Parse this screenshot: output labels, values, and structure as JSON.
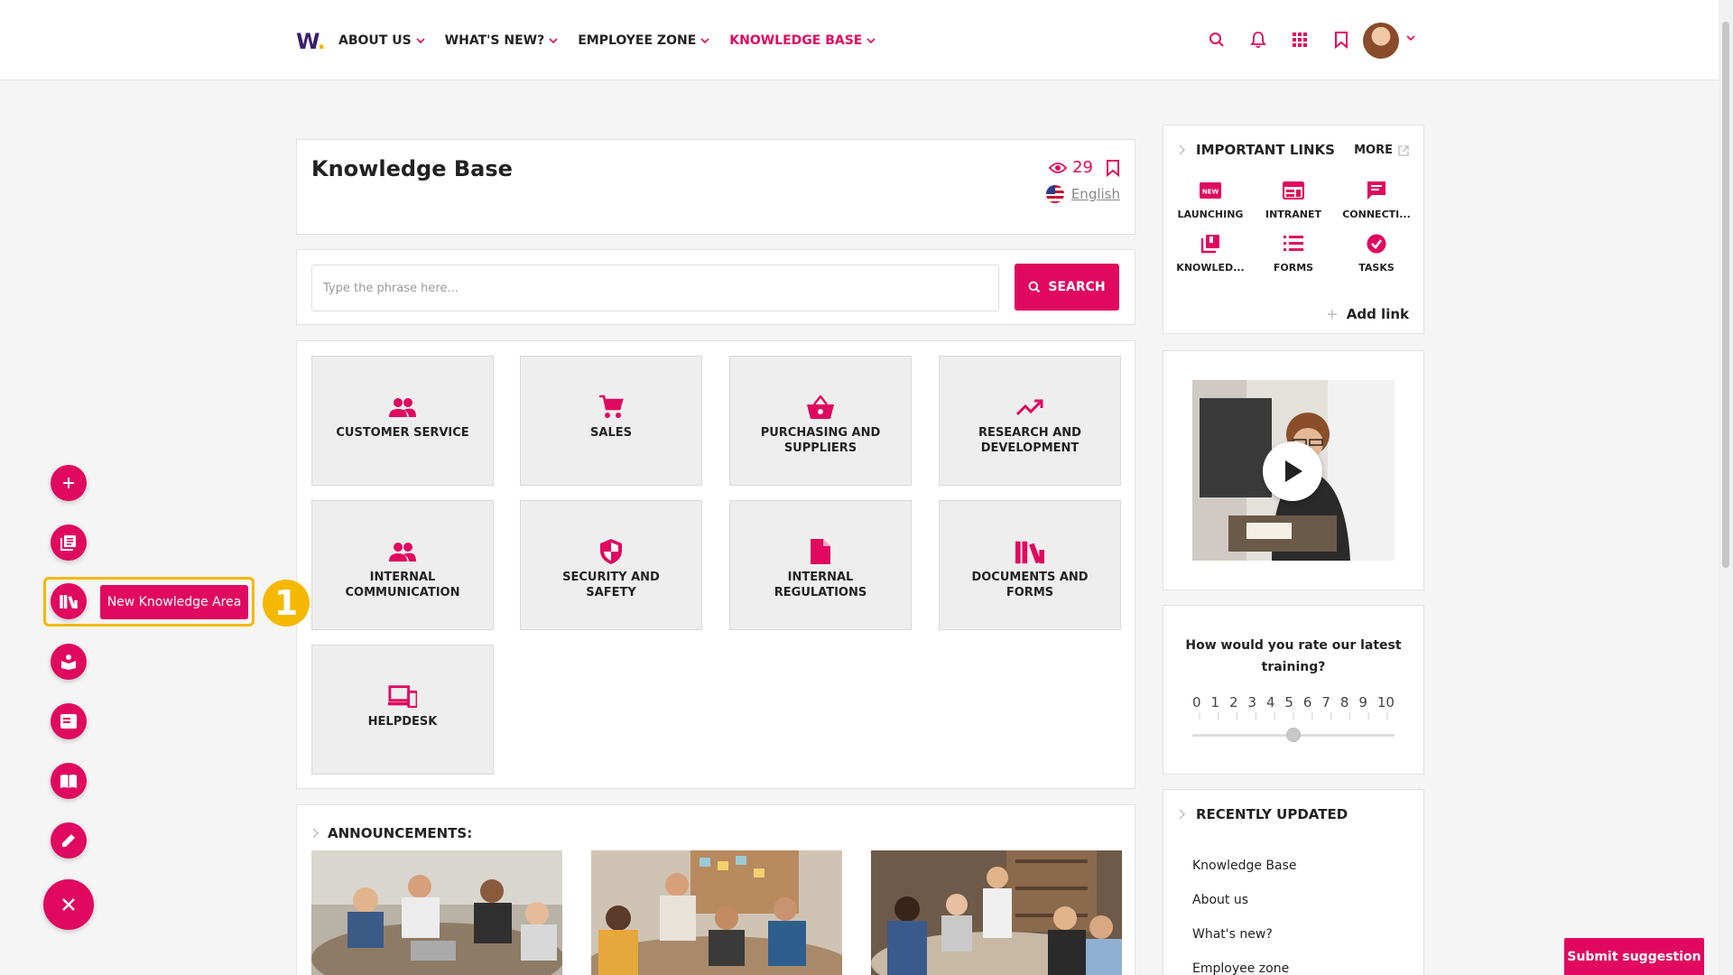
{
  "header": {
    "logo": "W",
    "nav": [
      {
        "label": "ABOUT US",
        "active": false
      },
      {
        "label": "WHAT'S NEW?",
        "active": false
      },
      {
        "label": "EMPLOYEE ZONE",
        "active": false
      },
      {
        "label": "KNOWLEDGE BASE",
        "active": true
      }
    ],
    "icons": [
      "search-icon",
      "bell-icon",
      "apps-grid-icon",
      "bookmark-icon"
    ]
  },
  "page": {
    "title": "Knowledge Base",
    "views": "29",
    "language": "English"
  },
  "search": {
    "placeholder": "Type the phrase here...",
    "button_label": "SEARCH"
  },
  "areas": [
    {
      "label": "CUSTOMER SERVICE",
      "icon": "people-icon"
    },
    {
      "label": "SALES",
      "icon": "cart-icon"
    },
    {
      "label": "PURCHASING AND SUPPLIERS",
      "icon": "basket-icon"
    },
    {
      "label": "RESEARCH AND DEVELOPMENT",
      "icon": "trending-up-icon"
    },
    {
      "label": "INTERNAL COMMUNICATION",
      "icon": "people-icon"
    },
    {
      "label": "SECURITY AND SAFETY",
      "icon": "shield-icon"
    },
    {
      "label": "INTERNAL REGULATIONS",
      "icon": "document-icon"
    },
    {
      "label": "DOCUMENTS AND FORMS",
      "icon": "library-icon"
    },
    {
      "label": "HELPDESK",
      "icon": "devices-icon"
    }
  ],
  "announcements": {
    "title": "ANNOUNCEMENTS:"
  },
  "important_links": {
    "title": "IMPORTANT LINKS",
    "more_label": "MORE",
    "items": [
      {
        "label": "LAUNCHING",
        "icon": "new-badge-icon"
      },
      {
        "label": "INTRANET",
        "icon": "web-icon"
      },
      {
        "label": "CONNECTI...",
        "icon": "chat-icon"
      },
      {
        "label": "KNOWLED...",
        "icon": "library-books-icon"
      },
      {
        "label": "FORMS",
        "icon": "list-icon"
      },
      {
        "label": "TASKS",
        "icon": "check-circle-icon"
      }
    ],
    "add_label": "Add link"
  },
  "poll": {
    "question": "How would you rate our latest training?",
    "scale": [
      "0",
      "1",
      "2",
      "3",
      "4",
      "5",
      "6",
      "7",
      "8",
      "9",
      "10"
    ],
    "value": 5
  },
  "recently_updated": {
    "title": "RECENTLY UPDATED",
    "items": [
      "Knowledge Base",
      "About us",
      "What's new?",
      "Employee zone"
    ]
  },
  "fab": {
    "tooltip": "New Knowledge Area",
    "step": "1"
  },
  "submit_label": "Submit suggestion",
  "colors": {
    "accent": "#e0095f",
    "highlight": "#f5b800",
    "logo": "#3a1f6e"
  }
}
